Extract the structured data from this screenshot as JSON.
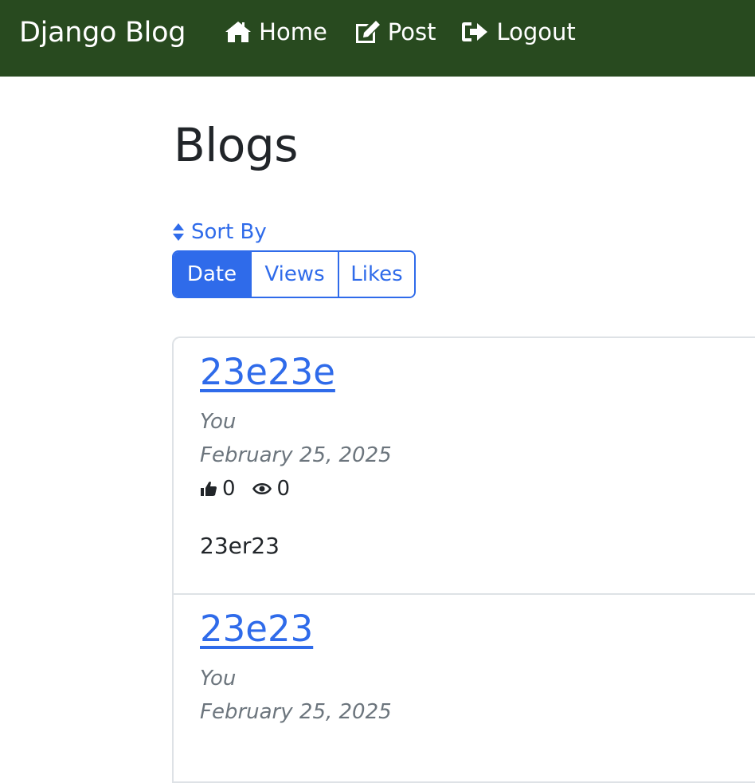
{
  "navbar": {
    "brand": "Django Blog",
    "links": [
      {
        "label": "Home",
        "icon": "home-icon"
      },
      {
        "label": "Post",
        "icon": "edit-icon"
      },
      {
        "label": "Logout",
        "icon": "logout-icon"
      }
    ]
  },
  "page": {
    "title": "Blogs",
    "sort_label": "Sort By",
    "sort_icon": "sort-icon",
    "sort_options": [
      "Date",
      "Views",
      "Likes"
    ],
    "active_sort": "Date"
  },
  "posts": [
    {
      "title": "23e23e",
      "author": "You",
      "date": "February 25, 2025",
      "likes": "0",
      "views": "0",
      "body": "23er23"
    },
    {
      "title": "23e23",
      "author": "You",
      "date": "February 25, 2025"
    }
  ],
  "colors": {
    "navbar_bg": "#284a1f",
    "accent": "#2f6bea",
    "muted": "#6c757d"
  }
}
